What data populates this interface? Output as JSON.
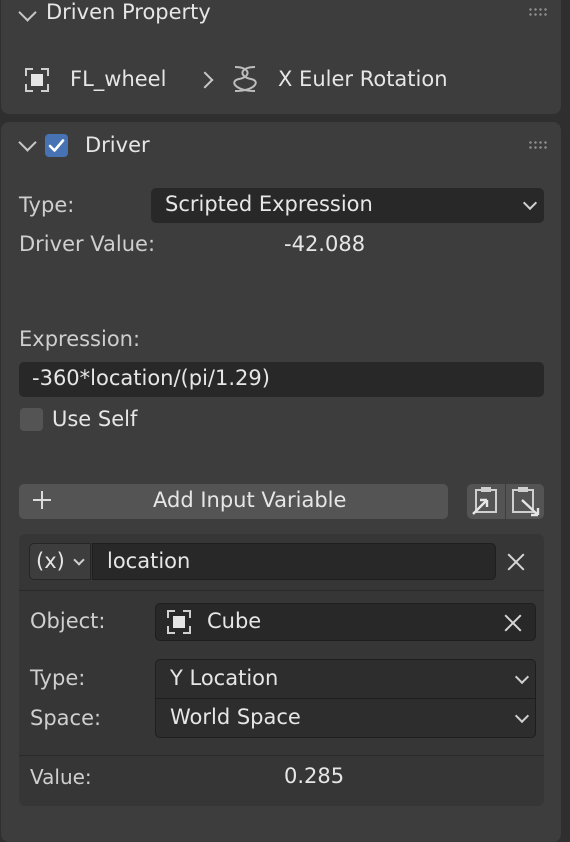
{
  "driven_property": {
    "title": "Driven Property",
    "object_name": "FL_wheel",
    "property_name": "X Euler Rotation"
  },
  "driver": {
    "title": "Driver",
    "enabled": true,
    "type_label": "Type:",
    "type_value": "Scripted Expression",
    "driver_value_label": "Driver Value:",
    "driver_value": "-42.088",
    "expression_label": "Expression:",
    "expression_value": "-360*location/(pi/1.29)",
    "use_self_label": "Use Self",
    "use_self_checked": false,
    "add_variable_label": "Add Input Variable"
  },
  "variable": {
    "type_symbol": "(x)",
    "name": "location",
    "object_label": "Object:",
    "object_value": "Cube",
    "type_label": "Type:",
    "type_value": "Y Location",
    "space_label": "Space:",
    "space_value": "World Space",
    "value_label": "Value:",
    "value": "0.285"
  },
  "colors": {
    "accent_checkbox": "#4772b3",
    "panel_bg": "#3d3d3d",
    "field_bg": "#282828",
    "button_bg": "#545454"
  }
}
